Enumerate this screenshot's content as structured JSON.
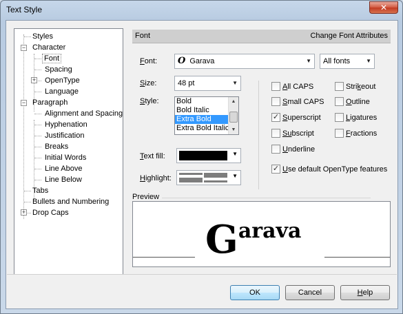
{
  "window": {
    "title": "Text Style",
    "close_label": "✕"
  },
  "tree": {
    "items": [
      {
        "label": "Styles"
      },
      {
        "label": "Character"
      },
      {
        "label": "Font"
      },
      {
        "label": "Spacing"
      },
      {
        "label": "OpenType"
      },
      {
        "label": "Language"
      },
      {
        "label": "Paragraph"
      },
      {
        "label": "Alignment and Spacing"
      },
      {
        "label": "Hyphenation"
      },
      {
        "label": "Justification"
      },
      {
        "label": "Breaks"
      },
      {
        "label": "Initial Words"
      },
      {
        "label": "Line Above"
      },
      {
        "label": "Line Below"
      },
      {
        "label": "Tabs"
      },
      {
        "label": "Bullets and Numbering"
      },
      {
        "label": "Drop Caps"
      }
    ],
    "expander_minus": "−",
    "expander_plus": "+"
  },
  "header": {
    "section": "Font",
    "action": "Change Font Attributes"
  },
  "font": {
    "label_accel": "F",
    "label_rest": "ont:",
    "icon_glyph": "O",
    "value": "Garava",
    "filter_value": "All fonts"
  },
  "size": {
    "label_accel": "S",
    "label_rest": "ize:",
    "value": "48 pt"
  },
  "style": {
    "label_accel": "S",
    "label_rest": "tyle:",
    "options": [
      "Bold",
      "Bold Italic",
      "Extra Bold",
      "Extra Bold Italic"
    ],
    "selected": "Extra Bold"
  },
  "text_fill": {
    "label_accel": "T",
    "label_rest": "ext fill:",
    "color": "#000000"
  },
  "highlight": {
    "label_accel": "H",
    "label_rest": "ighlight:"
  },
  "checkboxes": {
    "all_caps": {
      "accel": "A",
      "rest": "ll CAPS",
      "checked": false
    },
    "small_caps": {
      "accel": "S",
      "rest": "mall CAPS",
      "checked": false
    },
    "superscript": {
      "accel": "S",
      "rest": "uperscript",
      "checked": true
    },
    "subscript": {
      "accel": "Su",
      "rest": "bscript",
      "checked": false
    },
    "underline": {
      "accel": "U",
      "rest": "nderline",
      "checked": false
    },
    "strikeout": {
      "pre": "Stri",
      "accel": "k",
      "rest": "eout",
      "checked": false
    },
    "outline": {
      "accel": "O",
      "rest": "utline",
      "checked": false
    },
    "ligatures": {
      "accel": "L",
      "rest": "igatures",
      "checked": false
    },
    "fractions": {
      "accel": "F",
      "rest": "ractions",
      "checked": false
    },
    "opentype": {
      "accel": "U",
      "rest": "se default OpenType features",
      "checked": true
    }
  },
  "preview": {
    "label": "Preview",
    "cap": "G",
    "rest": "arava"
  },
  "buttons": {
    "ok": "OK",
    "cancel": "Cancel",
    "help_accel": "H",
    "help_rest": "elp"
  }
}
